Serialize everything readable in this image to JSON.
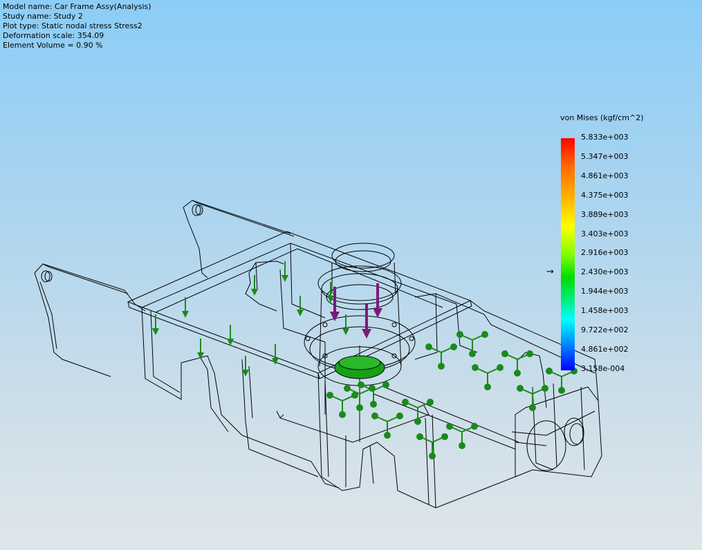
{
  "info": {
    "model_name": "Model name: Car Frame Assy(Analysis)",
    "study_name": "Study name: Study 2",
    "plot_type": "Plot type: Static nodal stress Stress2",
    "deformation_scale": "Deformation scale: 354.09",
    "element_volume": "Element Volume = 0.90 %"
  },
  "legend": {
    "title": "von Mises (kgf/cm^2)",
    "labels": [
      "5.833e+003",
      "5.347e+003",
      "4.861e+003",
      "4.375e+003",
      "3.889e+003",
      "3.403e+003",
      "2.916e+003",
      "2.430e+003",
      "1.944e+003",
      "1.458e+003",
      "9.722e+002",
      "4.861e+002",
      "3.158e-004"
    ],
    "max_color": "#ff0000",
    "min_color": "#0000ff",
    "pointer_symbol": "→"
  },
  "model": {
    "wireframe_color": "#000000",
    "load_arrow_color": "#7a1a7a",
    "fixture_color": "#1a8a1a"
  }
}
